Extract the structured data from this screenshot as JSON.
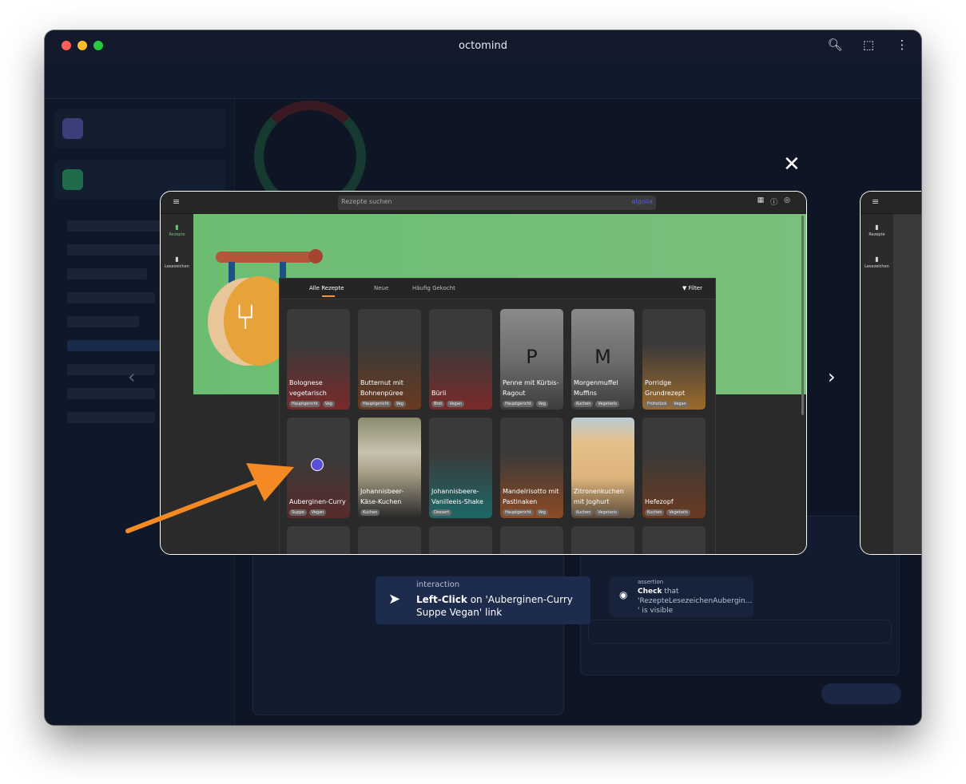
{
  "window": {
    "title": "octomind",
    "toolbar_icons": [
      "search-icon",
      "extension-icon",
      "more-icon"
    ]
  },
  "colors": {
    "accent_orange": "#f2943a",
    "hero_green": "#6cbd72",
    "click_marker": "#5a4fd8",
    "step_bg": "#1d2b4c"
  },
  "screenshot": {
    "search_placeholder": "Rezepte suchen",
    "search_powered": "algolia",
    "nav": [
      {
        "label": "Rezepte",
        "icon": "book-icon",
        "active": true
      },
      {
        "label": "Lesezeichen",
        "icon": "bookmark-icon",
        "active": false
      }
    ],
    "tabs": [
      "Alle Rezepte",
      "Neue",
      "Häufig Gekocht"
    ],
    "active_tab": "Alle Rezepte",
    "filter_label": "Filter",
    "recipes_row1": [
      {
        "title": "Bolognese vegetarisch",
        "tags": [
          "Hauptgericht",
          "Veg"
        ]
      },
      {
        "title": "Butternut mit Bohnenpüree",
        "tags": [
          "Hauptgericht",
          "Veg"
        ]
      },
      {
        "title": "Bürli",
        "tags": [
          "Brot",
          "Vegan"
        ]
      },
      {
        "title": "Penne mit Kürbis-Ragout",
        "letter": "P",
        "tags": [
          "Hauptgericht",
          "Veg"
        ]
      },
      {
        "title": "Morgenmuffel Muffins",
        "letter": "M",
        "tags": [
          "Kuchen",
          "Vegetaris"
        ]
      },
      {
        "title": "Porridge Grundrezept",
        "tags": [
          "Frühstück",
          "Vegan"
        ]
      }
    ],
    "recipes_row2": [
      {
        "title": "Auberginen-Curry",
        "tags": [
          "Suppe",
          "Vegan"
        ]
      },
      {
        "title": "Johannisbeer-Käse-Kuchen",
        "tags": [
          "Kuchen"
        ]
      },
      {
        "title": "Johannisbeere-Vanilleeis-Shake",
        "tags": [
          "Dessert"
        ]
      },
      {
        "title": "Mandelrisotto mit Pastinaken",
        "tags": [
          "Hauptgericht",
          "Veg"
        ]
      },
      {
        "title": "Zitronenkuchen mit Joghurt",
        "tags": [
          "Kuchen",
          "Vegetaris"
        ]
      },
      {
        "title": "Hefezopf",
        "tags": [
          "Kuchen",
          "Vegetaris"
        ]
      }
    ],
    "side_nav": [
      "Rezepte",
      "Lesezeichen"
    ]
  },
  "steps": {
    "current": {
      "type": "interaction",
      "action": "Left-Click",
      "text_on": "on 'Auberginen-Curry",
      "text_rest": "Suppe Vegan' link"
    },
    "next": {
      "type": "assertion",
      "action": "Check",
      "text_that": "that",
      "line2": "'RezepteLesezeichenAubergin...",
      "line3": "' is visible"
    }
  }
}
